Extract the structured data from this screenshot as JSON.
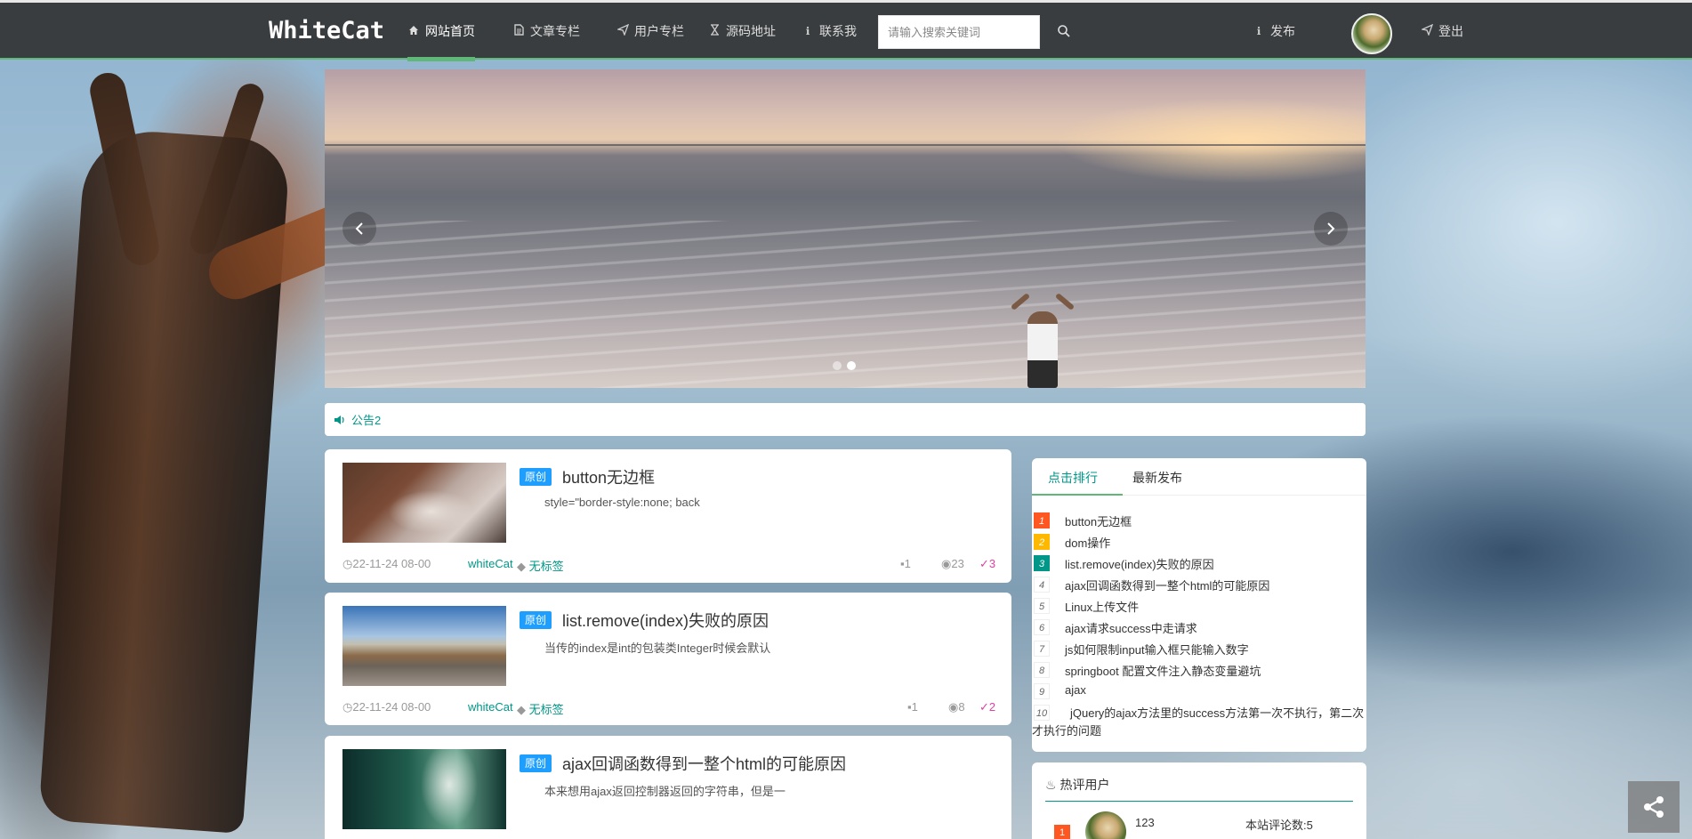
{
  "nav": {
    "logo": "WhiteCat",
    "items": [
      {
        "label": "网站首页",
        "icon": "home-icon",
        "active": true
      },
      {
        "label": "文章专栏",
        "icon": "file-icon"
      },
      {
        "label": "用户专栏",
        "icon": "paper-plane-icon"
      },
      {
        "label": "源码地址",
        "icon": "hourglass-icon"
      },
      {
        "label": "联系我",
        "icon": "info-icon"
      }
    ],
    "search_placeholder": "请输入搜索关键词",
    "publish_label": "发布",
    "logout_label": "登出"
  },
  "notice": {
    "text": "公告2"
  },
  "articles": [
    {
      "badge": "原创",
      "title": "button无边框",
      "summary": "style=\"border-style:none; back",
      "date": "22-11-24 08-00",
      "author": "whiteCat",
      "tag": "无标签",
      "comments": "1",
      "views": "23",
      "likes": "3"
    },
    {
      "badge": "原创",
      "title": "list.remove(index)失败的原因",
      "summary": "当传的index是int的包装类Integer时候会默认",
      "date": "22-11-24 08-00",
      "author": "whiteCat",
      "tag": "无标签",
      "comments": "1",
      "views": "8",
      "likes": "2"
    },
    {
      "badge": "原创",
      "title": "ajax回调函数得到一整个html的可能原因",
      "summary": "本来想用ajax返回控制器返回的字符串，但是一"
    }
  ],
  "rank": {
    "tabs": [
      "点击排行",
      "最新发布"
    ],
    "items": [
      {
        "num": "1",
        "title": "button无边框"
      },
      {
        "num": "2",
        "title": "dom操作"
      },
      {
        "num": "3",
        "title": "list.remove(index)失败的原因"
      },
      {
        "num": "4",
        "title": "ajax回调函数得到一整个html的可能原因"
      },
      {
        "num": "5",
        "title": "Linux上传文件"
      },
      {
        "num": "6",
        "title": "ajax请求success中走请求"
      },
      {
        "num": "7",
        "title": "js如何限制input输入框只能输入数字"
      },
      {
        "num": "8",
        "title": "springboot 配置文件注入静态变量避坑"
      },
      {
        "num": "9",
        "title": "ajax"
      },
      {
        "num": "10",
        "title": "jQuery的ajax方法里的success方法第一次不执行，第二次才执行的问题"
      }
    ]
  },
  "hot_users": {
    "title": "热评用户",
    "users": [
      {
        "num": "1",
        "name": "123",
        "count": "本站评论数:5"
      }
    ]
  },
  "colors": {
    "accent": "#5FB878",
    "teal": "#009688",
    "badge_blue": "#1E9FFF",
    "rank1": "#FF5722",
    "rank2": "#FFB800",
    "like_pink": "#e040a0",
    "navbar": "#393d3f"
  }
}
